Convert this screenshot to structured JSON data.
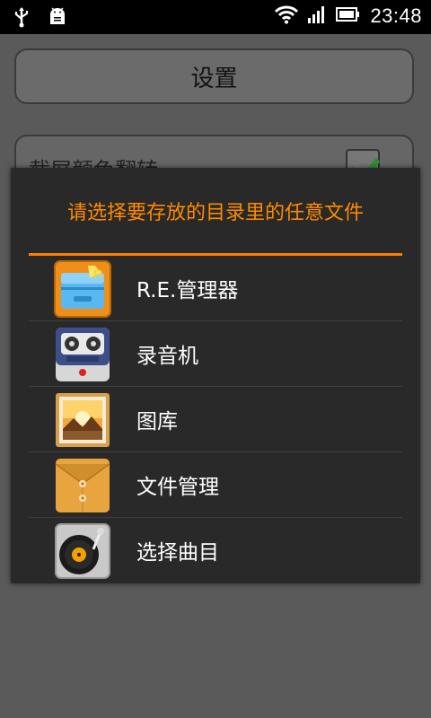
{
  "status_bar": {
    "time": "23:48",
    "left_icons": [
      "usb-icon",
      "android-debug-icon"
    ],
    "right_icons": [
      "wifi-icon",
      "signal-icon",
      "battery-icon"
    ]
  },
  "settings": {
    "title": "设置",
    "row_label": "截屏颜色翻转"
  },
  "dialog": {
    "title": "请选择要存放的目录里的任意文件",
    "accent_color": "#ff7f00",
    "items": [
      {
        "label": "R.E.管理器",
        "icon": "re-manager-icon"
      },
      {
        "label": "录音机",
        "icon": "recorder-icon"
      },
      {
        "label": "图库",
        "icon": "gallery-icon"
      },
      {
        "label": "文件管理",
        "icon": "file-manager-icon"
      },
      {
        "label": "选择曲目",
        "icon": "music-picker-icon"
      }
    ]
  }
}
